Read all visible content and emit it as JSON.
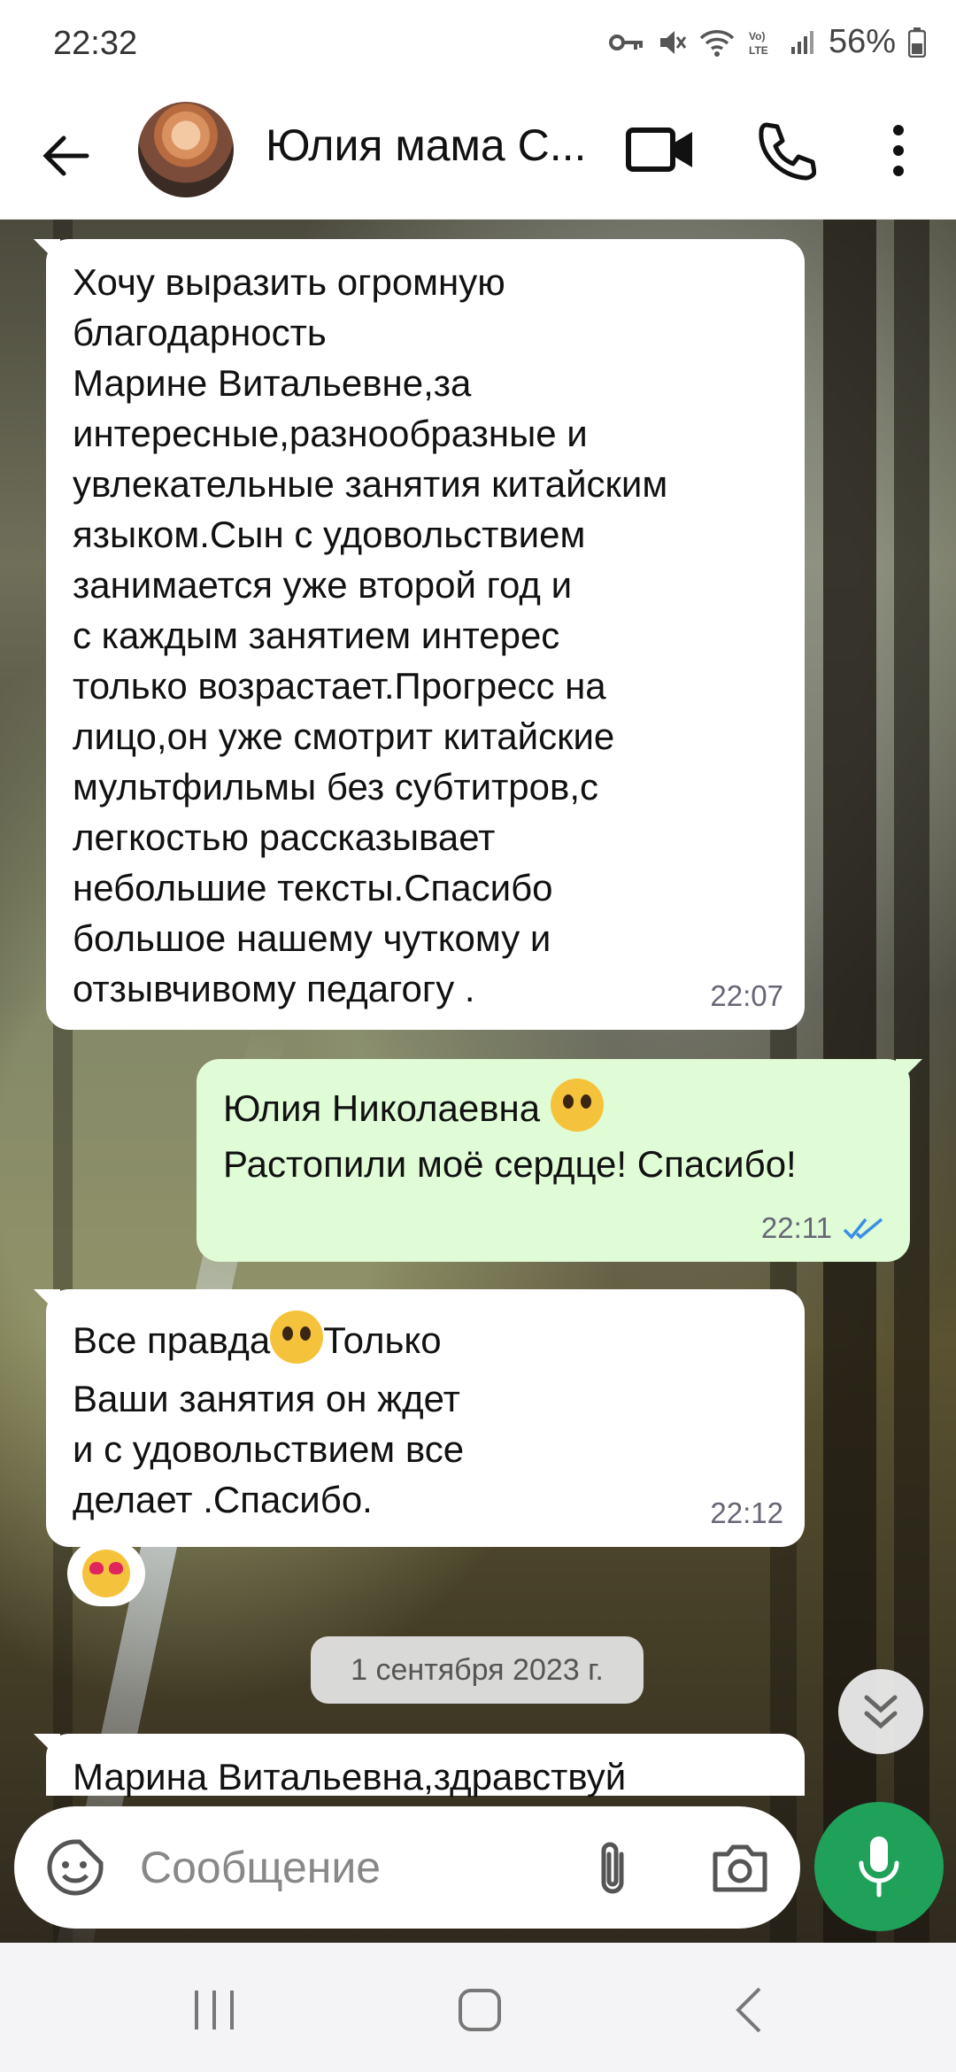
{
  "status_bar": {
    "time": "22:32",
    "battery": "56%"
  },
  "header": {
    "contact_name": "Юлия мама С..."
  },
  "messages": [
    {
      "text": "Хочу выразить огромную\nблагодарность\nМарине Витальевне,за\nинтересные,разнообразные и\nувлекательные занятия китайским\nязыком.Сын с удовольствием\nзанимается уже второй год и\nс каждым занятием интерес\nтолько  возрастает.Прогресс на\nлицо,он уже смотрит китайские\nмультфильмы без субтитров,с\nлегкостью рассказывает\nнебольшие тексты.Спасибо\nбольшое нашему чуткому и\nотзывчивому педагогу .",
      "time": "22:07"
    },
    {
      "line1": "Юлия Николаевна",
      "line2": "Растопили моё сердце! Спасибо!",
      "time": "22:11"
    },
    {
      "line1_a": "Все правда",
      "line1_b": "Только",
      "rest": "Ваши занятия он ждет\nи с удовольствием все\nделает .Спасибо.",
      "time": "22:12"
    },
    {
      "text": "Марина Витальевна,здравствуй"
    }
  ],
  "date_separator": "1 сентября 2023 г.",
  "composer": {
    "placeholder": "Сообщение"
  }
}
